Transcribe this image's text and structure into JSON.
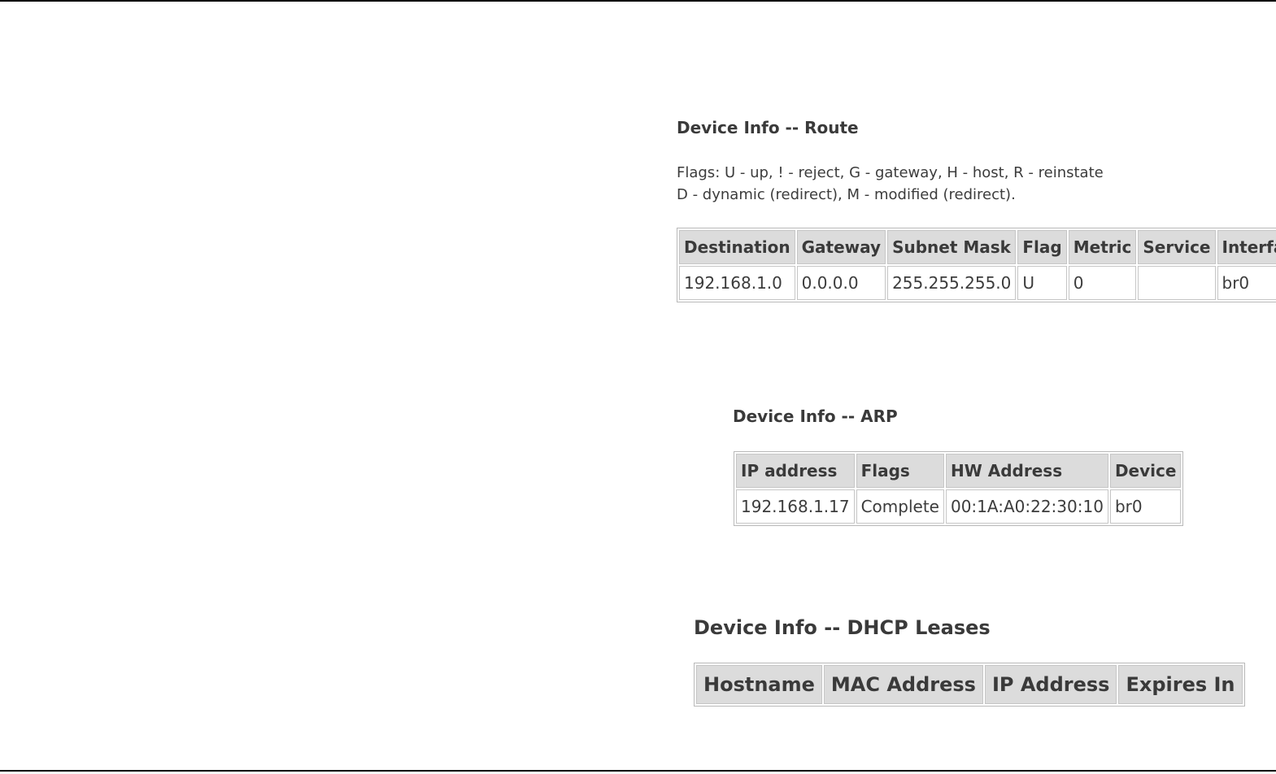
{
  "route": {
    "title": "Device Info -- Route",
    "flags_line1": "Flags: U - up, ! - reject, G - gateway, H - host, R - reinstate",
    "flags_line2": "D - dynamic (redirect), M - modified (redirect).",
    "columns": [
      "Destination",
      "Gateway",
      "Subnet Mask",
      "Flag",
      "Metric",
      "Service",
      "Interface"
    ],
    "rows": [
      [
        "192.168.1.0",
        "0.0.0.0",
        "255.255.255.0",
        "U",
        "0",
        "",
        "br0"
      ]
    ]
  },
  "arp": {
    "title": "Device Info -- ARP",
    "columns": [
      "IP address",
      "Flags",
      "HW Address",
      "Device"
    ],
    "rows": [
      [
        "192.168.1.17",
        "Complete",
        "00:1A:A0:22:30:10",
        "br0"
      ]
    ]
  },
  "dhcp": {
    "title": "Device Info -- DHCP Leases",
    "columns": [
      "Hostname",
      "MAC Address",
      "IP Address",
      "Expires In"
    ]
  }
}
